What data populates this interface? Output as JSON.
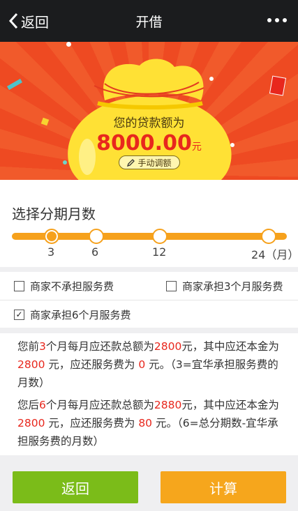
{
  "header": {
    "back_label": "返回",
    "title": "开借"
  },
  "banner": {
    "loan_label": "您的贷款额为",
    "amount": "8000.00",
    "unit": "元",
    "adjust_label": "手动调额"
  },
  "term": {
    "title": "选择分期月数",
    "ticks": [
      "3",
      "6",
      "12",
      "24（月）"
    ],
    "selected": "3"
  },
  "options": [
    {
      "label": "商家不承担服务费",
      "checked": false
    },
    {
      "label": "商家承担3个月服务费",
      "checked": false
    },
    {
      "label": "商家承担6个月服务费",
      "checked": true
    }
  ],
  "info": {
    "p1": {
      "a": "您前",
      "n1": "3",
      "b": "个月每月应还款总额为",
      "n2": "2800",
      "c": "元，其中应还本金为 ",
      "n3": "2800",
      "d": " 元，应还服务费为 ",
      "n4": "0",
      "e": " 元。（3=宜华承担服务费的月数）"
    },
    "p2": {
      "a": "您后",
      "n1": "6",
      "b": "个月每月应还款总额为",
      "n2": "2880",
      "c": "元，其中应还本金为 ",
      "n3": "2800",
      "d": " 元，应还服务费为 ",
      "n4": "80",
      "e": " 元。（6=总分期数-宜华承担服务费的月数）"
    }
  },
  "buttons": {
    "back_label": "返回",
    "calc_label": "计算"
  },
  "colors": {
    "accent_orange": "#f6a11c",
    "accent_green": "#7bbc19",
    "banner_red": "#f15a2b",
    "highlight_red": "#e8271d"
  }
}
